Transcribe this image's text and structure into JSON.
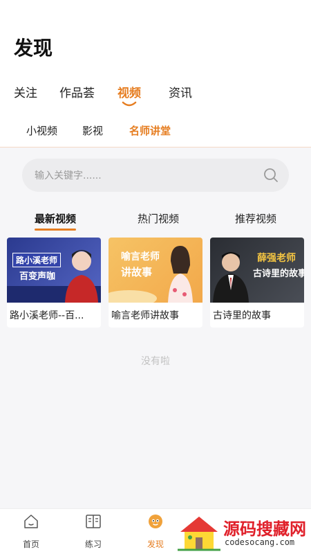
{
  "page": {
    "title": "发现"
  },
  "main_tabs": [
    {
      "label": "关注",
      "active": false
    },
    {
      "label": "作品荟",
      "active": false
    },
    {
      "label": "视频",
      "active": true
    },
    {
      "label": "资讯",
      "active": false
    }
  ],
  "sub_tabs": [
    {
      "label": "小视频",
      "active": false
    },
    {
      "label": "影视",
      "active": false
    },
    {
      "label": "名师讲堂",
      "active": true
    }
  ],
  "search": {
    "placeholder": "输入关键字......",
    "icon": "search-icon"
  },
  "video_tabs": [
    {
      "label": "最新视频",
      "active": true
    },
    {
      "label": "热门视频",
      "active": false
    },
    {
      "label": "推荐视频",
      "active": false
    }
  ],
  "videos": [
    {
      "title": "路小溪老师--百...",
      "thumb_text_1": "路小溪老师",
      "thumb_text_2": "百变声咖"
    },
    {
      "title": "喻言老师讲故事",
      "thumb_text_1": "喻言老师",
      "thumb_text_2": "讲故事"
    },
    {
      "title": "古诗里的故事",
      "thumb_text_1": "薛强老师",
      "thumb_text_2": "古诗里的故事"
    }
  ],
  "empty_text": "没有啦",
  "bottom_nav": [
    {
      "label": "首页",
      "icon": "home-icon",
      "active": false
    },
    {
      "label": "练习",
      "icon": "book-icon",
      "active": false
    },
    {
      "label": "发现",
      "icon": "discover-icon",
      "active": true
    }
  ],
  "watermark": {
    "title": "源码搜藏网",
    "url": "codesocang.com"
  },
  "colors": {
    "accent": "#e67e22",
    "background": "#f6f6f8",
    "watermark_red": "#e0202a"
  }
}
